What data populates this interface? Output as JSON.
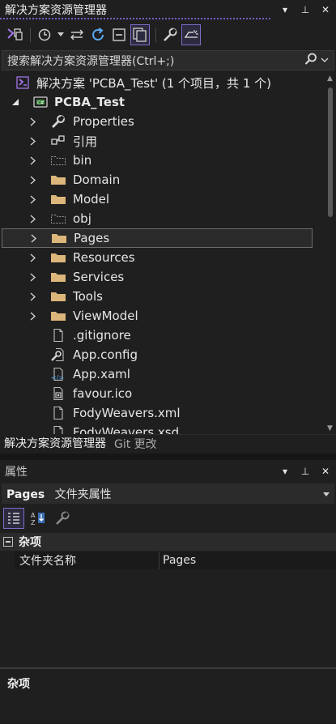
{
  "solution_explorer": {
    "title": "解决方案资源管理器",
    "window_buttons": [
      "▾",
      "⊥",
      "✕"
    ],
    "toolbar": {
      "buttons": [
        "vs-switch-views-icon",
        "history-icon",
        "dropdown-icon",
        "sync-icon",
        "refresh-icon",
        "collapse-all-icon",
        "show-all-files-icon",
        "properties-wrench-icon",
        "preview-selected-icon"
      ]
    },
    "search": {
      "placeholder": "搜索解决方案资源管理器(Ctrl+;)"
    },
    "tree": [
      {
        "label": "解决方案 'PCBA_Test' (1 个项目，共 1 个)",
        "icon": "solution-icon",
        "arrow": "none",
        "bold": false
      },
      {
        "label": "PCBA_Test",
        "icon": "csharp-project-icon",
        "arrow": "expanded",
        "bold": true
      },
      {
        "label": "Properties",
        "icon": "wrench-icon",
        "arrow": "collapsed",
        "bold": false
      },
      {
        "label": "引用",
        "icon": "references-icon",
        "arrow": "collapsed",
        "bold": false
      },
      {
        "label": "bin",
        "icon": "hidden-folder-icon",
        "arrow": "collapsed",
        "bold": false
      },
      {
        "label": "Domain",
        "icon": "folder-icon",
        "arrow": "collapsed",
        "bold": false
      },
      {
        "label": "Model",
        "icon": "folder-icon",
        "arrow": "collapsed",
        "bold": false
      },
      {
        "label": "obj",
        "icon": "hidden-folder-icon",
        "arrow": "collapsed",
        "bold": false
      },
      {
        "label": "Pages",
        "icon": "folder-icon",
        "arrow": "collapsed",
        "bold": false,
        "selected": true
      },
      {
        "label": "Resources",
        "icon": "folder-icon",
        "arrow": "collapsed",
        "bold": false
      },
      {
        "label": "Services",
        "icon": "folder-icon",
        "arrow": "collapsed",
        "bold": false
      },
      {
        "label": "Tools",
        "icon": "folder-icon",
        "arrow": "collapsed",
        "bold": false
      },
      {
        "label": "ViewModel",
        "icon": "folder-icon",
        "arrow": "collapsed",
        "bold": false
      },
      {
        "label": ".gitignore",
        "icon": "file-icon",
        "arrow": "none",
        "bold": false
      },
      {
        "label": "App.config",
        "icon": "config-file-icon",
        "arrow": "none",
        "bold": false
      },
      {
        "label": "App.xaml",
        "icon": "xaml-file-icon",
        "arrow": "none",
        "bold": false
      },
      {
        "label": "favour.ico",
        "icon": "ico-file-icon",
        "arrow": "none",
        "bold": false
      },
      {
        "label": "FodyWeavers.xml",
        "icon": "file-icon",
        "arrow": "none",
        "bold": false
      },
      {
        "label": "FodyWeavers.xsd",
        "icon": "file-icon",
        "arrow": "none",
        "bold": false
      }
    ],
    "bottom_tabs": [
      {
        "label": "解决方案资源管理器",
        "active": true
      },
      {
        "label": "Git 更改",
        "active": false
      }
    ]
  },
  "properties": {
    "title": "属性",
    "window_buttons": [
      "▾",
      "⊥",
      "✕"
    ],
    "object_name": "Pages",
    "object_type": "文件夹属性",
    "toolbar": [
      "categorized-icon",
      "alphabetical-icon",
      "property-pages-icon"
    ],
    "category": "杂项",
    "rows": [
      {
        "name": "文件夹名称",
        "value": "Pages"
      }
    ],
    "description_title": "杂项"
  },
  "colors": {
    "background": "#1f1f1f",
    "accent": "#7b6ec7",
    "folder": "#dcb67a"
  }
}
